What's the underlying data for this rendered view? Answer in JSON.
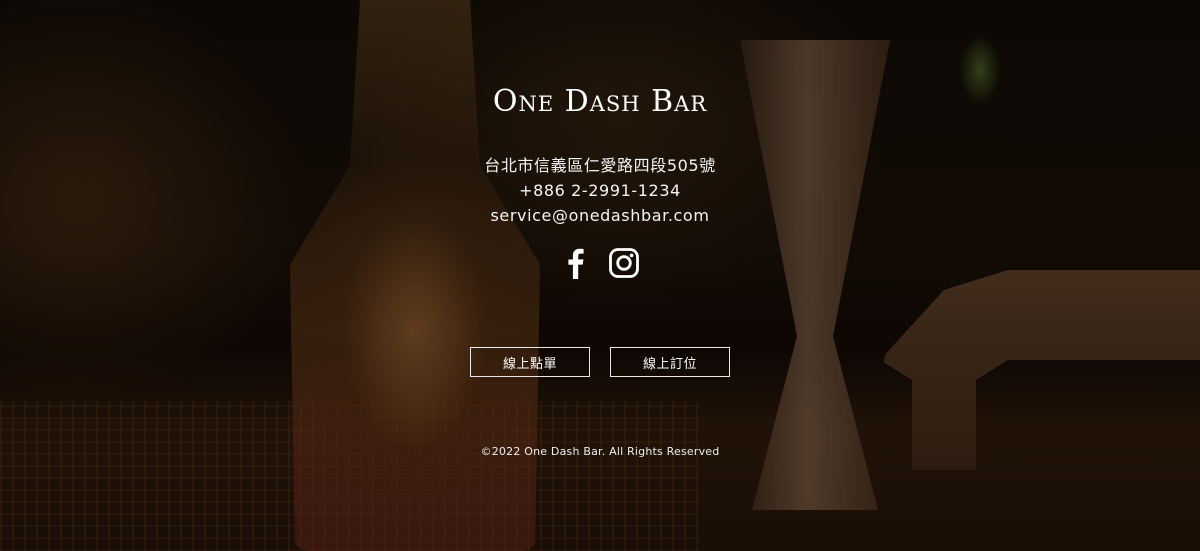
{
  "brand": {
    "name": "One Dash Bar"
  },
  "contact": {
    "address": "台北市信義區仁愛路四段505號",
    "phone": "+886 2-2991-1234",
    "email": "service@onedashbar.com"
  },
  "social": [
    {
      "icon": "facebook-icon"
    },
    {
      "icon": "instagram-icon"
    }
  ],
  "buttons": {
    "order_online": "線上點單",
    "book_online": "線上訂位"
  },
  "footer": {
    "copyright": "©2022 One Dash Bar. All Rights Reserved"
  }
}
